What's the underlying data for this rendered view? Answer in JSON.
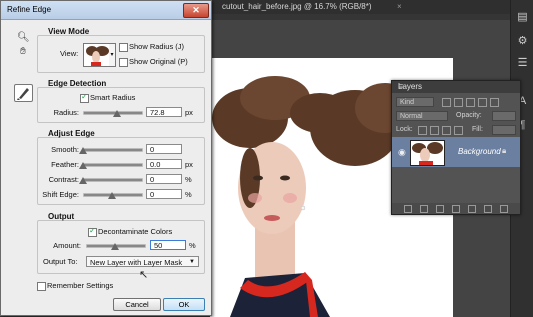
{
  "photoshop": {
    "document_tab": "cutout_hair_before.jpg @ 16.7% (RGB/8*)",
    "tab_close": "×"
  },
  "dialog": {
    "title": "Refine Edge",
    "close_glyph": "✕",
    "view_mode": {
      "heading": "View Mode",
      "view_label": "View:",
      "show_radius": {
        "label": "Show Radius (J)",
        "checked": false
      },
      "show_original": {
        "label": "Show Original (P)",
        "checked": false
      }
    },
    "edge_detection": {
      "heading": "Edge Detection",
      "smart_radius": {
        "label": "Smart Radius",
        "checked": true
      },
      "radius": {
        "label": "Radius:",
        "value": "72.8",
        "unit": "px",
        "level": 0.58
      }
    },
    "adjust_edge": {
      "heading": "Adjust Edge",
      "smooth": {
        "label": "Smooth:",
        "value": "0",
        "unit": "",
        "level": 0.0
      },
      "feather": {
        "label": "Feather:",
        "value": "0.0",
        "unit": "px",
        "level": 0.0
      },
      "contrast": {
        "label": "Contrast:",
        "value": "0",
        "unit": "%",
        "level": 0.0
      },
      "shift_edge": {
        "label": "Shift Edge:",
        "value": "0",
        "unit": "%",
        "level": 0.5
      }
    },
    "output": {
      "heading": "Output",
      "decontaminate": {
        "label": "Decontaminate Colors",
        "checked": true
      },
      "amount": {
        "label": "Amount:",
        "value": "50",
        "unit": "%",
        "level": 0.5
      },
      "output_to_label": "Output To:",
      "output_to_value": "New Layer with Layer Mask"
    },
    "remember_settings": {
      "label": "Remember Settings",
      "checked": false
    },
    "cancel_label": "Cancel",
    "ok_label": "OK"
  },
  "layers_panel": {
    "title": "Layers",
    "menu_glyph": "≡",
    "filter_kind": "Kind",
    "blend_mode": "Normal",
    "opacity_label": "Opacity:",
    "opacity_value": "",
    "lock_label": "Lock:",
    "fill_label": "Fill:",
    "layer_name": "Background"
  },
  "colors": {
    "dialog_bg": "#ededed",
    "selected_layer": "#6b7fa0",
    "workspace": "#3a3a3a",
    "hair": "#5a3a26",
    "dress_red": "#d7281f"
  }
}
